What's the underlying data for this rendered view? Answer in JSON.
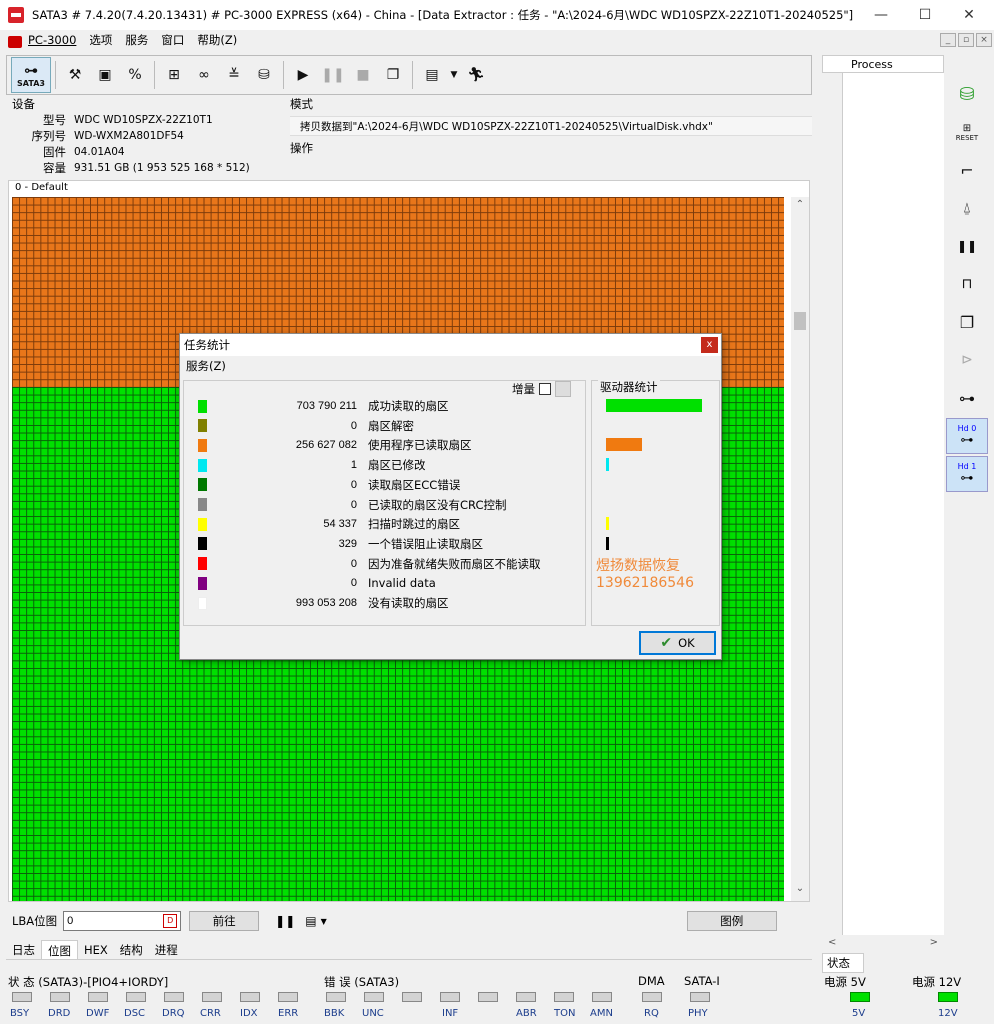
{
  "window": {
    "title": "SATA3 # 7.4.20(7.4.20.13431) # PC-3000 EXPRESS (x64) - China - [Data Extractor : 任务 - \"A:\\2024-6月\\WDC WD10SPZX-22Z10T1-20240525\"]",
    "minimize": "—",
    "maximize": "☐",
    "close": "✕"
  },
  "menu": {
    "items": [
      "PC-3000",
      "选项",
      "服务",
      "窗口",
      "帮助(Z)"
    ]
  },
  "toolbar": {
    "sata_label": "SATA3",
    "buttons": [
      "wrench-icon",
      "drive-icon",
      "percent-icon",
      "tree-icon",
      "binoculars-icon",
      "layers-icon",
      "image-icon",
      "play-icon",
      "pause-icon",
      "stop-icon",
      "copy-icon",
      "screen-icon",
      "dropdown-icon",
      "runner-icon"
    ]
  },
  "device": {
    "section_title": "设备",
    "rows": [
      {
        "key": "型号",
        "value": "WDC WD10SPZX-22Z10T1"
      },
      {
        "key": "序列号",
        "value": "WD-WXM2A801DF54"
      },
      {
        "key": "固件",
        "value": "04.01A04"
      },
      {
        "key": "容量",
        "value": "931.51 GB (1 953 525 168 * 512)"
      }
    ]
  },
  "mode": {
    "section_title": "模式",
    "value": "拷贝数据到\"A:\\2024-6月\\WDC WD10SPZX-22Z10T1-20240525\\VirtualDisk.vhdx\"",
    "ops_title": "操作"
  },
  "map": {
    "label": "0 - Default",
    "colors": {
      "read": "#00e000",
      "program_read": "#e8761a"
    },
    "program_read_fraction": 0.27,
    "read_fraction": 0.73
  },
  "lba": {
    "label": "LBA位图",
    "value": "0",
    "go_button": "前往",
    "legend_button": "图例"
  },
  "tabs": [
    "日志",
    "位图",
    "HEX",
    "结构",
    "进程"
  ],
  "tabs_active": "位图",
  "status": {
    "state_title": "状 态 (SATA3)-[PIO4+IORDY]",
    "state_leds": [
      "BSY",
      "DRD",
      "DWF",
      "DSC",
      "DRQ",
      "CRR",
      "IDX",
      "ERR"
    ],
    "error_title": "错 误 (SATA3)",
    "error_leds": [
      "BBK",
      "UNC",
      "",
      "INF",
      "",
      "ABR",
      "TON",
      "AMN"
    ],
    "dma_title": "DMA",
    "dma_leds": [
      "RQ"
    ],
    "sata_title": "SATA-I",
    "sata_leds": [
      "PHY"
    ],
    "power5_title": "电源 5V",
    "power5_led": "5V",
    "power12_title": "电源 12V",
    "power12_led": "12V"
  },
  "side": {
    "process_header": "Process",
    "status_tab": "状态",
    "scroll_left": "<",
    "scroll_right": ">"
  },
  "right_tools": {
    "reset_label": "RESET",
    "hd0": "Hd 0",
    "hd1": "Hd 1"
  },
  "dialog": {
    "title": "任务统计",
    "close": "x",
    "menu": "服务(Z)",
    "incremental_label": "增量",
    "drive_stats_title": "驱动器统计",
    "ok_label": "OK",
    "watermark_line1": "煜扬数据恢复",
    "watermark_line2": "13962186546",
    "stats": [
      {
        "color": "#00e000",
        "count": "703 790 211",
        "label": "成功读取的扇区",
        "bar": 0.73
      },
      {
        "color": "#808000",
        "count": "0",
        "label": "扇区解密",
        "bar": 0
      },
      {
        "color": "#f07a10",
        "count": "256 627 082",
        "label": "使用程序已读取扇区",
        "bar": 0.27
      },
      {
        "color": "#00e8f0",
        "count": "1",
        "label": "扇区已修改",
        "bar": 0.02
      },
      {
        "color": "#007800",
        "count": "0",
        "label": "读取扇区ECC错误",
        "bar": 0
      },
      {
        "color": "#888888",
        "count": "0",
        "label": "已读取的扇区没有CRC控制",
        "bar": 0
      },
      {
        "color": "#ffff00",
        "count": "54 337",
        "label": "扫描时跳过的扇区",
        "bar": 0.02
      },
      {
        "color": "#000000",
        "count": "329",
        "label": "一个错误阻止读取扇区",
        "bar": 0.02
      },
      {
        "color": "#ff0000",
        "count": "0",
        "label": "因为准备就绪失败而扇区不能读取",
        "bar": 0
      },
      {
        "color": "#800080",
        "count": "0",
        "label": "Invalid data",
        "bar": 0
      },
      {
        "color": "#ffffff",
        "count": "993 053 208",
        "label": "没有读取的扇区",
        "bar": 0
      }
    ]
  }
}
